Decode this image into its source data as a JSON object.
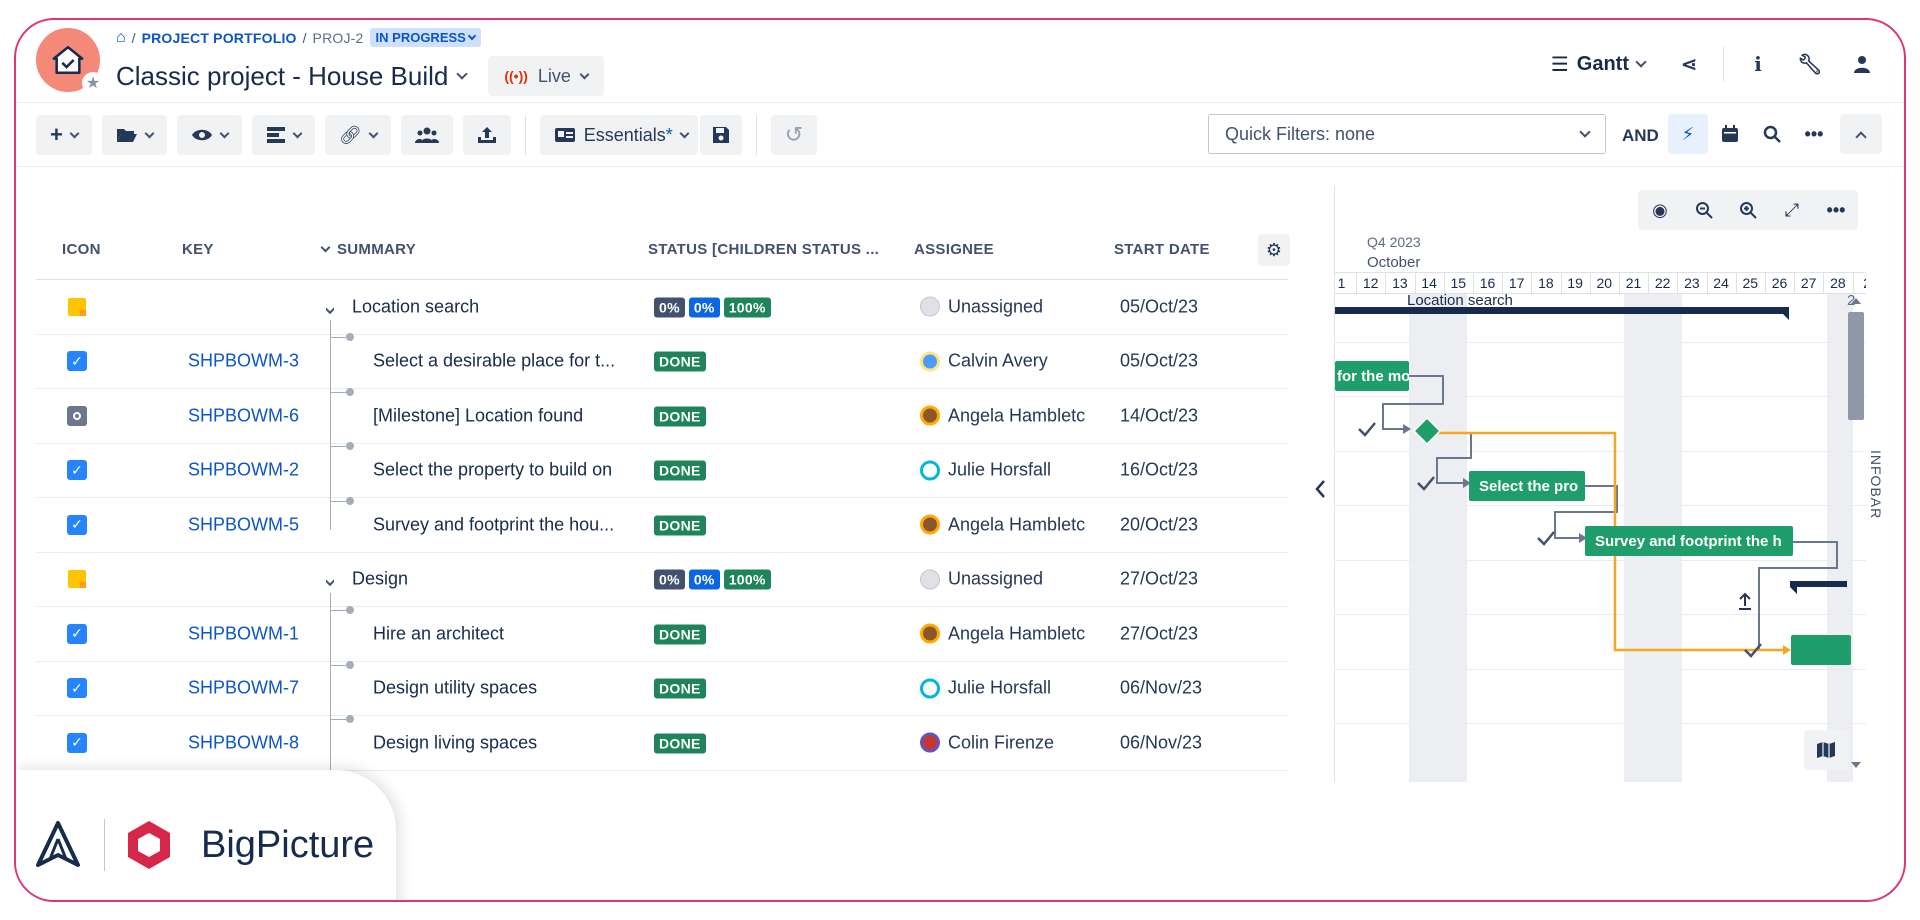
{
  "breadcrumb": {
    "portfolio": "PROJECT PORTFOLIO",
    "project_key": "PROJ-2",
    "status": "IN PROGRESS"
  },
  "project": {
    "title": "Classic project - House Build",
    "mode": "Live"
  },
  "view": {
    "name": "Gantt"
  },
  "toolbar": {
    "essentials": "Essentials",
    "essentials_modified": "*"
  },
  "filters": {
    "quick_filters": "Quick Filters: none",
    "logic": "AND"
  },
  "table": {
    "columns": {
      "icon": "ICON",
      "key": "KEY",
      "summary": "SUMMARY",
      "status": "STATUS [CHILDREN STATUS ...",
      "assignee": "ASSIGNEE",
      "start": "START DATE"
    },
    "rows": [
      {
        "type": "epic",
        "key": "",
        "summary": "Location search",
        "pct": [
          "0%",
          "0%",
          "100%"
        ],
        "status": "",
        "assignee": "Unassigned",
        "start": "05/Oct/23"
      },
      {
        "type": "task",
        "key": "SHPBOWM-3",
        "summary": "Select a desirable place for t...",
        "status": "DONE",
        "assignee": "Calvin Avery",
        "start": "05/Oct/23"
      },
      {
        "type": "milestone",
        "key": "SHPBOWM-6",
        "summary": "[Milestone] Location found",
        "status": "DONE",
        "assignee": "Angela Hambletc",
        "start": "14/Oct/23"
      },
      {
        "type": "task",
        "key": "SHPBOWM-2",
        "summary": "Select the property to build on",
        "status": "DONE",
        "assignee": "Julie Horsfall",
        "start": "16/Oct/23"
      },
      {
        "type": "task",
        "key": "SHPBOWM-5",
        "summary": "Survey and footprint the hou...",
        "status": "DONE",
        "assignee": "Angela Hambletc",
        "start": "20/Oct/23"
      },
      {
        "type": "epic",
        "key": "",
        "summary": "Design",
        "pct": [
          "0%",
          "0%",
          "100%"
        ],
        "status": "",
        "assignee": "Unassigned",
        "start": "27/Oct/23"
      },
      {
        "type": "task",
        "key": "SHPBOWM-1",
        "summary": "Hire an architect",
        "status": "DONE",
        "assignee": "Angela Hambletc",
        "start": "27/Oct/23"
      },
      {
        "type": "task",
        "key": "SHPBOWM-7",
        "summary": "Design utility spaces",
        "status": "DONE",
        "assignee": "Julie Horsfall",
        "start": "06/Nov/23"
      },
      {
        "type": "task",
        "key": "SHPBOWM-8",
        "summary": "Design living spaces",
        "status": "DONE",
        "assignee": "Colin Firenze",
        "start": "06/Nov/23"
      }
    ]
  },
  "gantt": {
    "quarter": "Q4 2023",
    "month": "October",
    "days": [
      "1",
      "12",
      "13",
      "14",
      "15",
      "16",
      "17",
      "18",
      "19",
      "20",
      "21",
      "22",
      "23",
      "24",
      "25",
      "26",
      "27",
      "28",
      "2"
    ],
    "bars": {
      "epic1": "Location search",
      "bar1": "for the mo",
      "bar2": "Select the pro",
      "bar3": "Survey and footprint the h",
      "next_label": "2"
    },
    "infobar": "INFOBAR"
  },
  "brand": {
    "name": "BigPicture"
  },
  "colors": {
    "accent": "#0c55c6",
    "done": "#1f845a",
    "bar": "#1f9d6a",
    "frame": "#e0337a",
    "dep_line": "#f5a623"
  }
}
